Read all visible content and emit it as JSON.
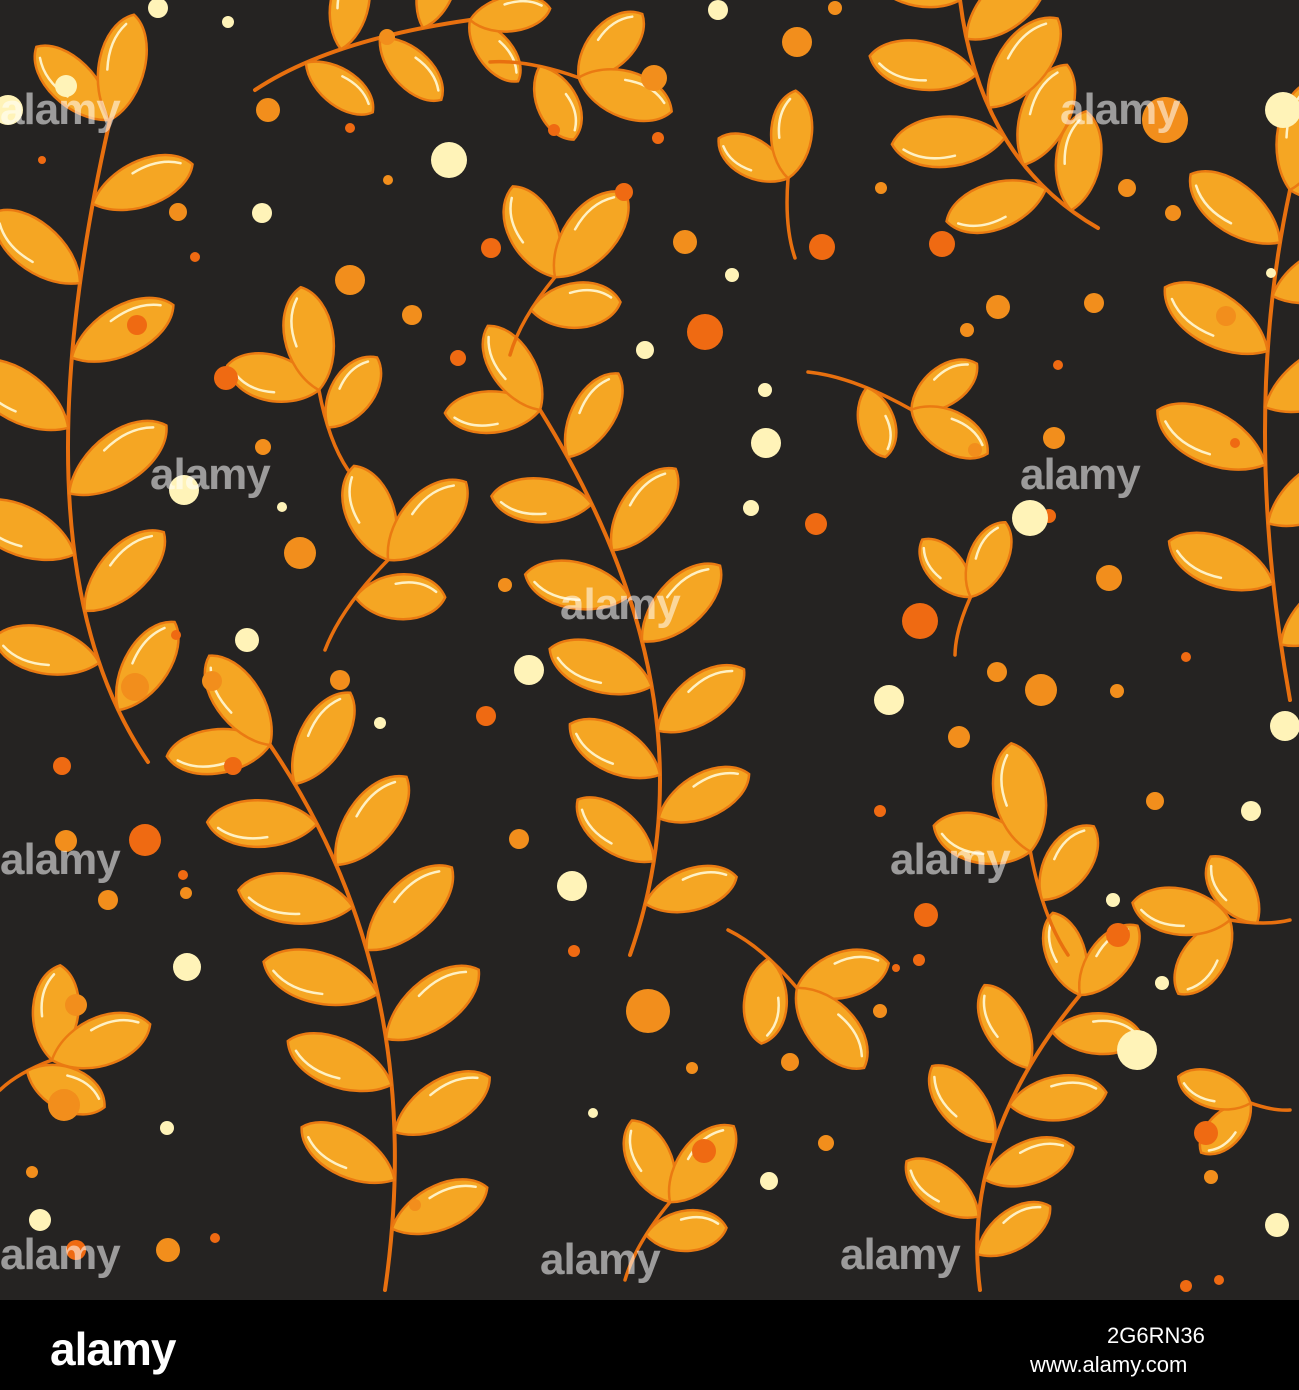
{
  "image": {
    "subject": "Seamless autumn pattern of orange leafy branches and scattered dots on a dark background",
    "background_color": "#252322",
    "leaf_color": "#f5a623",
    "leaf_outline_color": "#ea7a12",
    "stem_color": "#e8700f",
    "highlight_color": "#fff1c4",
    "dot_colors": [
      "#fff3b8",
      "#f28e1c",
      "#ef6a12",
      "#f5a623"
    ]
  },
  "watermark": {
    "text": "alamy"
  },
  "footer": {
    "logo": "alamy",
    "image_id": "2G6RN36",
    "site": "www.alamy.com"
  }
}
